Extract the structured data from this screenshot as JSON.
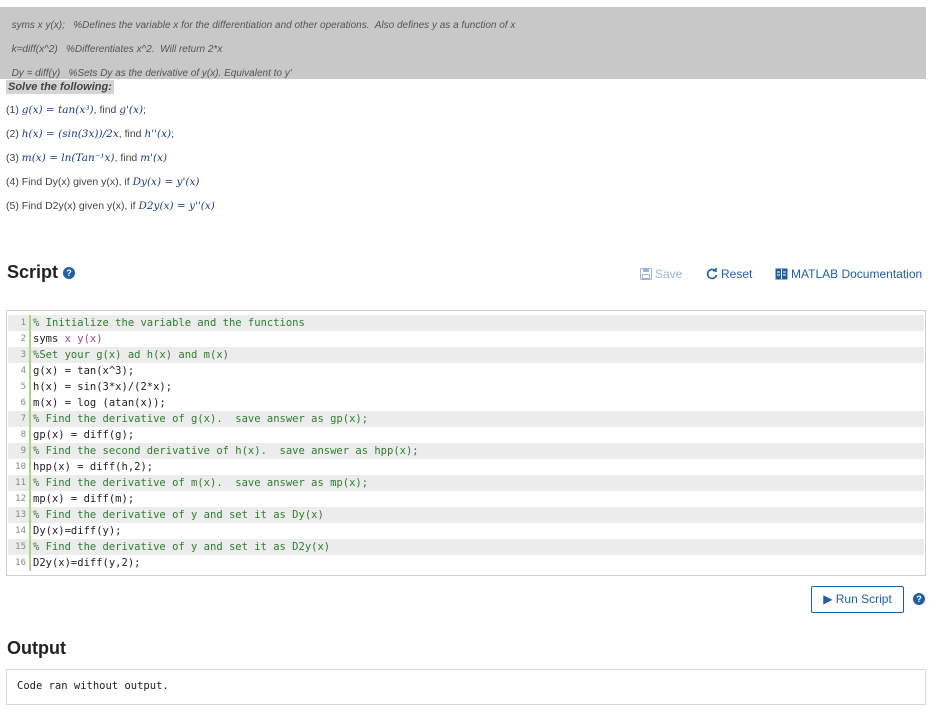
{
  "header_notes": [
    {
      "code": "syms x y(x);",
      "comment": "%Defines the variable x for the differentiation and other operations.  Also defines y as a function of x"
    },
    {
      "code": "k=diff(x^2)",
      "comment": "%Differentiates x^2.  Will return 2*x"
    },
    {
      "code": "Dy = diff(y)",
      "comment": "%Sets Dy as the derivative of y(x). Equivalent to y'"
    }
  ],
  "solve_heading": "Solve the following:",
  "problems": [
    {
      "prefix": "(1) ",
      "expr": "g(x) = tan(x³)",
      "mid": ", find ",
      "target": "g'(x)",
      "suffix": ";"
    },
    {
      "prefix": "(2) ",
      "expr": "h(x) = (sin(3x))/2x",
      "mid": ", find ",
      "target": "h''(x)",
      "suffix": ";"
    },
    {
      "prefix": "(3) ",
      "expr": "m(x) = ln(Tan⁻¹x)",
      "mid": ", find ",
      "target": "m'(x)",
      "suffix": ""
    },
    {
      "prefix": "(4) Find Dy(x) given y(x), if ",
      "expr": "Dy(x) = y'(x)",
      "mid": "",
      "target": "",
      "suffix": ""
    },
    {
      "prefix": "(5) Find D2y(x) given y(x), if ",
      "expr": "D2y(x) = y''(x)",
      "mid": "",
      "target": "",
      "suffix": ""
    }
  ],
  "script": {
    "title": "Script",
    "toolbar": {
      "save": "Save",
      "reset": "Reset",
      "docs": "MATLAB Documentation"
    },
    "lines": [
      {
        "n": "1",
        "text": "% Initialize the variable and the functions",
        "kind": "comment"
      },
      {
        "n": "2",
        "text": "syms x y(x)",
        "kind": "syms"
      },
      {
        "n": "3",
        "text": "%Set your g(x) ad h(x) and m(x)",
        "kind": "comment"
      },
      {
        "n": "4",
        "text": "g(x) = tan(x^3);",
        "kind": "plain"
      },
      {
        "n": "5",
        "text": "h(x) = sin(3*x)/(2*x);",
        "kind": "plain"
      },
      {
        "n": "6",
        "text": "m(x) = log (atan(x));",
        "kind": "plain"
      },
      {
        "n": "7",
        "text": "% Find the derivative of g(x).  save answer as gp(x);",
        "kind": "comment"
      },
      {
        "n": "8",
        "text": "gp(x) = diff(g);",
        "kind": "plain"
      },
      {
        "n": "9",
        "text": "% Find the second derivative of h(x).  save answer as hpp(x);",
        "kind": "comment"
      },
      {
        "n": "10",
        "text": "hpp(x) = diff(h,2);",
        "kind": "plain"
      },
      {
        "n": "11",
        "text": "% Find the derivative of m(x).  save answer as mp(x);",
        "kind": "comment"
      },
      {
        "n": "12",
        "text": "mp(x) = diff(m);",
        "kind": "plain"
      },
      {
        "n": "13",
        "text": "% Find the derivative of y and set it as Dy(x)",
        "kind": "comment"
      },
      {
        "n": "14",
        "text": "Dy(x)=diff(y);",
        "kind": "plain"
      },
      {
        "n": "15",
        "text": "% Find the derivative of y and set it as D2y(x)",
        "kind": "comment"
      },
      {
        "n": "16",
        "text": "D2y(x)=diff(y,2);",
        "kind": "plain"
      }
    ],
    "run_label": "Run Script"
  },
  "output": {
    "title": "Output",
    "text": "Code ran without output."
  },
  "icons": {
    "help": "help-circle-icon",
    "save": "save-disk-icon",
    "reset": "reset-arrow-icon",
    "docs": "documentation-icon",
    "run": "play-icon"
  },
  "colors": {
    "link": "#1e5fa8",
    "comment": "#2f7d2f",
    "keyword_var": "#a23fa0",
    "gutter_bar": "#b6d08a"
  }
}
